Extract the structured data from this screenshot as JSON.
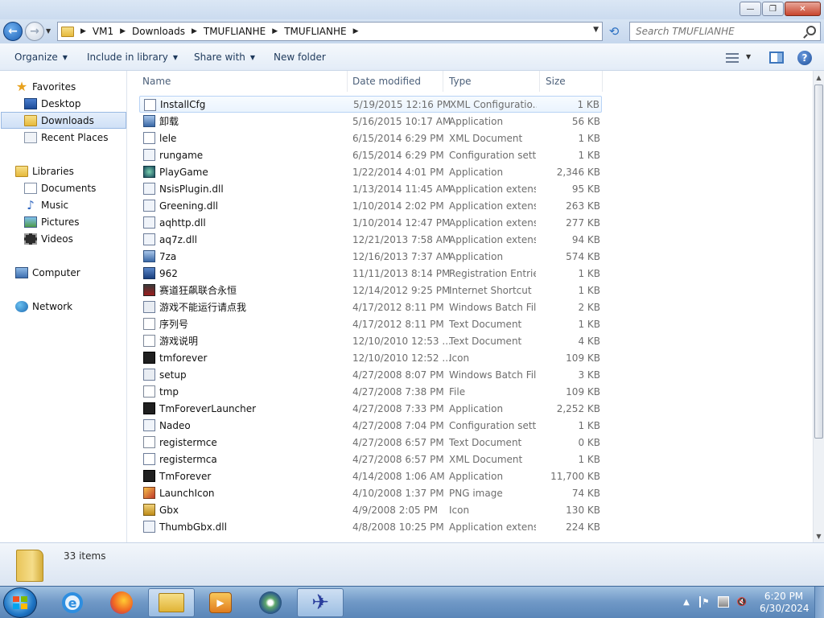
{
  "address": {
    "crumbs": [
      "VM1",
      "Downloads",
      "TMUFLIANHE",
      "TMUFLIANHE"
    ]
  },
  "search": {
    "placeholder": "Search TMUFLIANHE"
  },
  "commands": {
    "organize": "Organize",
    "include_in_library": "Include in library",
    "share_with": "Share with",
    "new_folder": "New folder"
  },
  "navigation": {
    "favorites": "Favorites",
    "desktop": "Desktop",
    "downloads": "Downloads",
    "recent_places": "Recent Places",
    "libraries": "Libraries",
    "documents": "Documents",
    "music": "Music",
    "pictures": "Pictures",
    "videos": "Videos",
    "computer": "Computer",
    "network": "Network"
  },
  "columns": {
    "name": "Name",
    "date_modified": "Date modified",
    "type": "Type",
    "size": "Size"
  },
  "files": [
    {
      "name": "InstallCfg",
      "date": "5/19/2015 12:16 PM",
      "type": "XML Configuratio...",
      "size": "1 KB",
      "icon": "xml-config-icon"
    },
    {
      "name": "卸载",
      "date": "5/16/2015 10:17 AM",
      "type": "Application",
      "size": "56 KB",
      "icon": "uninstall-app-icon"
    },
    {
      "name": "lele",
      "date": "6/15/2014 6:29 PM",
      "type": "XML Document",
      "size": "1 KB",
      "icon": "xml-document-icon"
    },
    {
      "name": "rungame",
      "date": "6/15/2014 6:29 PM",
      "type": "Configuration sett...",
      "size": "1 KB",
      "icon": "config-file-icon"
    },
    {
      "name": "PlayGame",
      "date": "1/22/2014 4:01 PM",
      "type": "Application",
      "size": "2,346 KB",
      "icon": "playgame-app-icon"
    },
    {
      "name": "NsisPlugin.dll",
      "date": "1/13/2014 11:45 AM",
      "type": "Application extens...",
      "size": "95 KB",
      "icon": "dll-icon"
    },
    {
      "name": "Greening.dll",
      "date": "1/10/2014 2:02 PM",
      "type": "Application extens...",
      "size": "263 KB",
      "icon": "dll-icon"
    },
    {
      "name": "aqhttp.dll",
      "date": "1/10/2014 12:47 PM",
      "type": "Application extens...",
      "size": "277 KB",
      "icon": "dll-icon"
    },
    {
      "name": "aq7z.dll",
      "date": "12/21/2013 7:58 AM",
      "type": "Application extens...",
      "size": "94 KB",
      "icon": "dll-icon"
    },
    {
      "name": "7za",
      "date": "12/16/2013 7:37 AM",
      "type": "Application",
      "size": "574 KB",
      "icon": "console-app-icon"
    },
    {
      "name": "962",
      "date": "11/11/2013 8:14 PM",
      "type": "Registration Entries",
      "size": "1 KB",
      "icon": "registry-icon"
    },
    {
      "name": "赛道狂飙联合永恒",
      "date": "12/14/2012 9:25 PM",
      "type": "Internet Shortcut",
      "size": "1 KB",
      "icon": "internet-shortcut-icon"
    },
    {
      "name": "游戏不能运行请点我",
      "date": "4/17/2012 8:11 PM",
      "type": "Windows Batch File",
      "size": "2 KB",
      "icon": "batch-file-icon"
    },
    {
      "name": "序列号",
      "date": "4/17/2012 8:11 PM",
      "type": "Text Document",
      "size": "1 KB",
      "icon": "text-document-icon"
    },
    {
      "name": "游戏说明",
      "date": "12/10/2010 12:53 ...",
      "type": "Text Document",
      "size": "4 KB",
      "icon": "text-document-icon"
    },
    {
      "name": "tmforever",
      "date": "12/10/2010 12:52 ...",
      "type": "Icon",
      "size": "109 KB",
      "icon": "tm-icon-file-icon"
    },
    {
      "name": "setup",
      "date": "4/27/2008 8:07 PM",
      "type": "Windows Batch File",
      "size": "3 KB",
      "icon": "batch-file-icon"
    },
    {
      "name": "tmp",
      "date": "4/27/2008 7:38 PM",
      "type": "File",
      "size": "109 KB",
      "icon": "generic-file-icon"
    },
    {
      "name": "TmForeverLauncher",
      "date": "4/27/2008 7:33 PM",
      "type": "Application",
      "size": "2,252 KB",
      "icon": "tm-launcher-app-icon"
    },
    {
      "name": "Nadeo",
      "date": "4/27/2008 7:04 PM",
      "type": "Configuration sett...",
      "size": "1 KB",
      "icon": "config-file-icon"
    },
    {
      "name": "registermce",
      "date": "4/27/2008 6:57 PM",
      "type": "Text Document",
      "size": "0 KB",
      "icon": "text-document-icon"
    },
    {
      "name": "registermca",
      "date": "4/27/2008 6:57 PM",
      "type": "XML Document",
      "size": "1 KB",
      "icon": "xml-document-icon"
    },
    {
      "name": "TmForever",
      "date": "4/14/2008 1:06 AM",
      "type": "Application",
      "size": "11,700 KB",
      "icon": "tm-app-icon"
    },
    {
      "name": "LaunchIcon",
      "date": "4/10/2008 1:37 PM",
      "type": "PNG image",
      "size": "74 KB",
      "icon": "png-image-icon"
    },
    {
      "name": "Gbx",
      "date": "4/9/2008 2:05 PM",
      "type": "Icon",
      "size": "130 KB",
      "icon": "gbx-icon-file-icon"
    },
    {
      "name": "ThumbGbx.dll",
      "date": "4/8/2008 10:25 PM",
      "type": "Application extens...",
      "size": "224 KB",
      "icon": "dll-icon"
    }
  ],
  "details": {
    "item_count": "33 items"
  },
  "taskbar": {
    "time": "6:20 PM",
    "date": "6/30/2024"
  }
}
